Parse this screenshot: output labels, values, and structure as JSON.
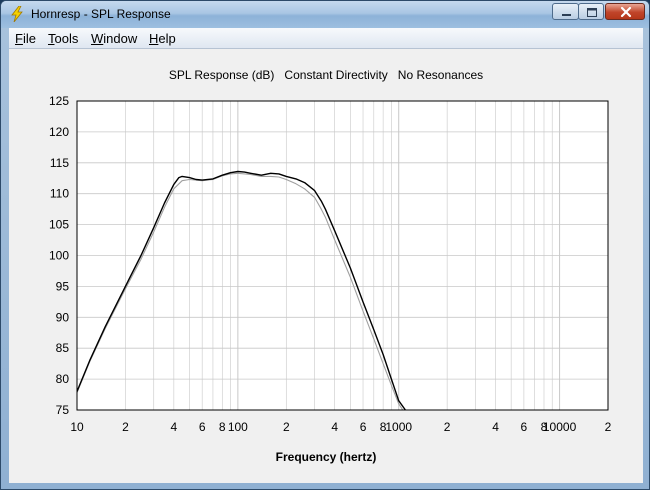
{
  "window": {
    "title": "Hornresp - SPL Response"
  },
  "menu": {
    "file": {
      "accel": "F",
      "rest": "ile"
    },
    "tools": {
      "accel": "T",
      "rest": "ools"
    },
    "window": {
      "accel": "W",
      "rest": "indow"
    },
    "help": {
      "accel": "H",
      "rest": "elp"
    }
  },
  "icons": {
    "app": "lightning-icon",
    "minimize": "minimize-icon",
    "maximize": "maximize-icon",
    "close": "close-icon"
  },
  "colors": {
    "plot_bg": "#ffffff",
    "grid": "#c8c8c8",
    "series_main": "#000000",
    "series_ref": "#a0a0a0"
  },
  "chart_data": {
    "type": "line",
    "title": "SPL Response (dB)   Constant Directivity   No Resonances",
    "xlabel": "Frequency (hertz)",
    "ylabel": "",
    "x_scale": "log",
    "xlim": [
      10,
      20000
    ],
    "ylim": [
      75,
      125
    ],
    "y_ticks": [
      75,
      80,
      85,
      90,
      95,
      100,
      105,
      110,
      115,
      120,
      125
    ],
    "x_tick_labels": [
      {
        "x": 10,
        "label": "10"
      },
      {
        "x": 20,
        "label": "2"
      },
      {
        "x": 40,
        "label": "4"
      },
      {
        "x": 60,
        "label": "6"
      },
      {
        "x": 80,
        "label": "8"
      },
      {
        "x": 100,
        "label": "100"
      },
      {
        "x": 200,
        "label": "2"
      },
      {
        "x": 400,
        "label": "4"
      },
      {
        "x": 600,
        "label": "6"
      },
      {
        "x": 800,
        "label": "8"
      },
      {
        "x": 1000,
        "label": "1000"
      },
      {
        "x": 2000,
        "label": "2"
      },
      {
        "x": 4000,
        "label": "4"
      },
      {
        "x": 6000,
        "label": "6"
      },
      {
        "x": 8000,
        "label": "8"
      },
      {
        "x": 10000,
        "label": "10000"
      },
      {
        "x": 20000,
        "label": "2"
      }
    ],
    "grid": true,
    "series": [
      {
        "x": [
          10,
          12,
          15,
          20,
          25,
          30,
          35,
          40,
          43,
          45,
          50,
          55,
          60,
          70,
          80,
          90,
          100,
          110,
          120,
          140,
          160,
          180,
          200,
          230,
          260,
          300,
          330,
          350,
          400,
          500,
          600,
          700,
          800,
          900,
          1000,
          1100
        ],
        "y": [
          78,
          83,
          88.5,
          95,
          100,
          104.5,
          108.5,
          111.5,
          112.6,
          112.8,
          112.6,
          112.3,
          112.2,
          112.4,
          113,
          113.4,
          113.6,
          113.5,
          113.3,
          113,
          113.3,
          113.2,
          112.8,
          112.4,
          111.8,
          110.5,
          108.8,
          107.5,
          104,
          98,
          92.5,
          88,
          84,
          80,
          76.5,
          75
        ]
      },
      {
        "x": [
          10,
          12,
          15,
          20,
          25,
          30,
          35,
          40,
          45,
          50,
          60,
          70,
          80,
          90,
          100,
          120,
          140,
          160,
          180,
          200,
          230,
          260,
          300,
          330,
          350,
          400,
          500,
          600,
          700,
          800,
          900,
          1000,
          1060
        ],
        "y": [
          77.8,
          82.8,
          88.2,
          94.6,
          99.4,
          103.8,
          107.8,
          110.8,
          112.1,
          112.3,
          112.1,
          112.3,
          112.9,
          113.2,
          113.3,
          113.1,
          112.8,
          112.8,
          112.7,
          112.3,
          111.6,
          110.8,
          109.4,
          107.5,
          106.2,
          102.5,
          96.5,
          91,
          86.5,
          82.5,
          79,
          76,
          75
        ]
      }
    ]
  }
}
